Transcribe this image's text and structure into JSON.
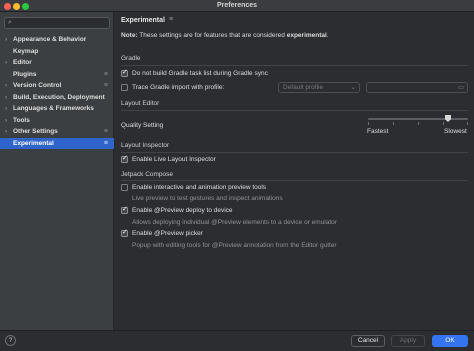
{
  "window": {
    "title": "Preferences"
  },
  "sidebar": {
    "search_placeholder": "",
    "items": [
      {
        "label": "Appearance & Behavior",
        "expandable": true,
        "flag": false,
        "selected": false
      },
      {
        "label": "Keymap",
        "expandable": false,
        "flag": false,
        "selected": false
      },
      {
        "label": "Editor",
        "expandable": true,
        "flag": false,
        "selected": false
      },
      {
        "label": "Plugins",
        "expandable": false,
        "flag": true,
        "selected": false
      },
      {
        "label": "Version Control",
        "expandable": true,
        "flag": true,
        "selected": false
      },
      {
        "label": "Build, Execution, Deployment",
        "expandable": true,
        "flag": false,
        "selected": false
      },
      {
        "label": "Languages & Frameworks",
        "expandable": true,
        "flag": false,
        "selected": false
      },
      {
        "label": "Tools",
        "expandable": true,
        "flag": false,
        "selected": false
      },
      {
        "label": "Other Settings",
        "expandable": true,
        "flag": true,
        "selected": false
      },
      {
        "label": "Experimental",
        "expandable": false,
        "flag": true,
        "selected": true
      }
    ]
  },
  "main": {
    "heading": "Experimental",
    "note_prefix": "Note:",
    "note_text": " These settings are for features that are considered ",
    "note_bold": "experimental",
    "note_suffix": ".",
    "gradle": {
      "section": "Gradle",
      "no_task_list": {
        "label": "Do not build Gradle task list during Gradle sync",
        "checked": true
      },
      "trace_import": {
        "label": "Trace Gradle import with profile:",
        "checked": false
      },
      "profile_combo": "Default profile"
    },
    "layout_editor": {
      "section": "Layout Editor",
      "quality_label": "Quality Setting",
      "fastest": "Fastest",
      "slowest": "Slowest",
      "quality_value": 0.8
    },
    "layout_inspector": {
      "section": "Layout Inspector",
      "live_inspector": {
        "label": "Enable Live Layout Inspector",
        "checked": true
      }
    },
    "jetpack_compose": {
      "section": "Jetpack Compose",
      "interactive_preview": {
        "label": "Enable interactive and animation preview tools",
        "checked": false,
        "desc": "Live preview to test gestures and inspect animations"
      },
      "deploy_preview": {
        "label": "Enable @Preview deploy to device",
        "checked": true,
        "desc": "Allows deploying individual @Preview elements to a device or emulator"
      },
      "preview_picker": {
        "label": "Enable @Preview picker",
        "checked": true,
        "desc": "Popup with editing tools for @Preview annotation from the Editor gutter"
      }
    }
  },
  "footer": {
    "help": "?",
    "cancel": "Cancel",
    "apply": "Apply",
    "ok": "OK"
  },
  "colors": {
    "accent": "#3574f0",
    "selection": "#2f65ca",
    "background": "#2b2d30",
    "sidebar": "#3c3f41"
  }
}
